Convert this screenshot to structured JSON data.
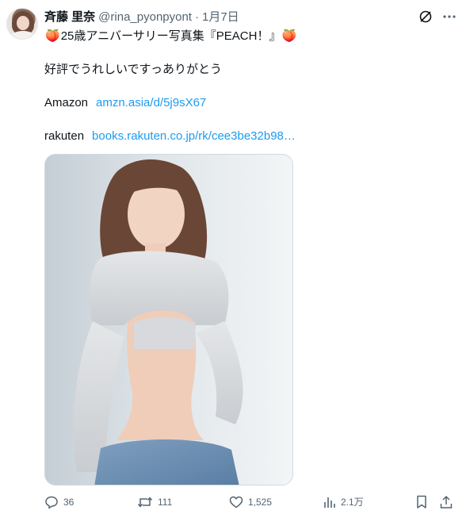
{
  "post": {
    "author_name": "斉藤 里奈",
    "handle": "@rina_pyonpyont",
    "separator": "·",
    "date": "1月7日",
    "title_emoji_left": "🍑",
    "title": "25歳アニバーサリー写真集『PEACH！』",
    "title_emoji_right": "🍑",
    "line2": "好評でうれしいですっありがとう",
    "amazon_label": "Amazon",
    "amazon_link": "amzn.asia/d/5j9sX67",
    "rakuten_label": "rakuten",
    "rakuten_link": "books.rakuten.co.jp/rk/cee3be32b98…"
  },
  "metrics": {
    "replies": "36",
    "reposts": "111",
    "likes": "1,525",
    "views": "2.1万"
  },
  "icons": {
    "grok": "grok-icon",
    "more": "more-icon",
    "reply": "reply-icon",
    "repost": "repost-icon",
    "like": "like-icon",
    "views": "views-icon",
    "bookmark": "bookmark-icon",
    "share": "share-icon"
  },
  "colors": {
    "text": "#0f1419",
    "secondary": "#536471",
    "link": "#1d9bf0",
    "border": "#cfd9de"
  }
}
